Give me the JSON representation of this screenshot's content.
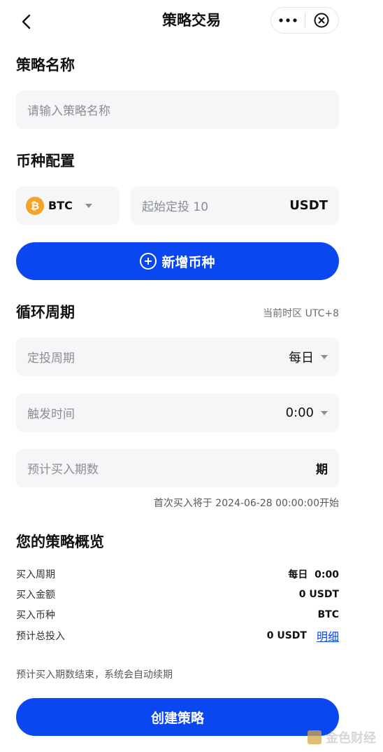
{
  "header": {
    "title": "策略交易",
    "back_icon": "chevron-left-icon",
    "more_icon": "more-dots-icon",
    "close_icon": "close-circle-icon"
  },
  "strategy_name": {
    "section_title": "策略名称",
    "placeholder": "请输入策略名称"
  },
  "coin_config": {
    "section_title": "币种配置",
    "coin": "BTC",
    "coin_logo_glyph": "₿",
    "amount_placeholder": "起始定投 10",
    "amount_unit": "USDT",
    "add_coin_label": "新增币种"
  },
  "cycle": {
    "section_title": "循环周期",
    "timezone": "当前时区 UTC+8",
    "period_label": "定投周期",
    "period_value": "每日",
    "trigger_label": "触发时间",
    "trigger_value": "0:00",
    "count_label": "预计买入期数",
    "count_unit": "期",
    "first_buy": "首次买入将于 2024-06-28 00:00:00开始"
  },
  "overview": {
    "section_title": "您的策略概览",
    "rows": [
      {
        "key": "买入周期",
        "value": "每日  0:00"
      },
      {
        "key": "买入金额",
        "value": "0 USDT"
      },
      {
        "key": "买入币种",
        "value": "BTC"
      },
      {
        "key": "预计总投入",
        "value": "0 USDT",
        "link": "明细"
      }
    ],
    "note": "预计买入期数结束，系统会自动续期"
  },
  "create_button_label": "创建策略",
  "watermark": "金色财经",
  "colors": {
    "primary": "#0a47f0",
    "btc": "#f7a32a",
    "field_bg": "#f5f6f7"
  }
}
